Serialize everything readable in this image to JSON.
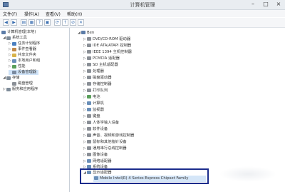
{
  "window": {
    "title": "计算机管理"
  },
  "menu": [
    "文件(F)",
    "操作(A)",
    "查看(V)",
    "帮助(H)"
  ],
  "left_tree": [
    {
      "label": "计算机管理(本地)",
      "twisty": "",
      "color": "#5d7da8"
    },
    {
      "label": "系统工具",
      "twisty": "◢",
      "color": "#7f8c99"
    },
    {
      "label": "任务计划程序",
      "twisty": "▷",
      "color": "#4a7fc0"
    },
    {
      "label": "事件查看器",
      "twisty": "▷",
      "color": "#c0884a"
    },
    {
      "label": "共享文件夹",
      "twisty": "▷",
      "color": "#d8b34a"
    },
    {
      "label": "本地用户和组",
      "twisty": "▷",
      "color": "#6a8fb8"
    },
    {
      "label": "性能",
      "twisty": "▷",
      "color": "#5aa05a"
    },
    {
      "label": "设备管理器",
      "twisty": "",
      "color": "#7a8aa0"
    },
    {
      "label": "存储",
      "twisty": "◢",
      "color": "#7f8c99"
    },
    {
      "label": "磁盘管理",
      "twisty": "",
      "color": "#8a8f96"
    },
    {
      "label": "服务和应用程序",
      "twisty": "▷",
      "color": "#7f8c99"
    }
  ],
  "device_tree": {
    "root": "Ben",
    "items": [
      {
        "label": "DVD/CD-ROM 驱动器",
        "color": "#8a8f96"
      },
      {
        "label": "IDE ATA/ATAPI 控制器",
        "color": "#8a8f96"
      },
      {
        "label": "IEEE 1394 主机控制器",
        "color": "#8a8f96"
      },
      {
        "label": "PCMCIA 适配器",
        "color": "#8a8f96"
      },
      {
        "label": "SD 主机适配器",
        "color": "#8a8f96"
      },
      {
        "label": "处理器",
        "color": "#8a8f96"
      },
      {
        "label": "磁盘驱动器",
        "color": "#8a8f96"
      },
      {
        "label": "存储控制器",
        "color": "#8a8f96"
      },
      {
        "label": "打印队列",
        "color": "#8a8f96"
      },
      {
        "label": "电池",
        "color": "#5aa05a"
      },
      {
        "label": "计算机",
        "color": "#6a8fb8"
      },
      {
        "label": "监视器",
        "color": "#6a8fb8"
      },
      {
        "label": "键盘",
        "color": "#8a8f96"
      },
      {
        "label": "人体学输入设备",
        "color": "#8a8f96"
      },
      {
        "label": "软件设备",
        "color": "#8a8f96"
      },
      {
        "label": "声音、视频和游戏控制器",
        "color": "#8a8f96"
      },
      {
        "label": "鼠标和其他指针设备",
        "color": "#8a8f96"
      },
      {
        "label": "通用串行总线控制器",
        "color": "#8a8f96"
      },
      {
        "label": "图像设备",
        "color": "#8a8f96"
      },
      {
        "label": "网络适配器",
        "color": "#6a8fb8"
      },
      {
        "label": "系统设备",
        "color": "#6a8fb8"
      },
      {
        "label": "显示适配器",
        "color": "#6a8fb8",
        "expanded": true
      }
    ],
    "child": {
      "label": "Mobile Intel(R) 4 Series Express Chipset Family",
      "color": "#6a8fb8"
    }
  }
}
